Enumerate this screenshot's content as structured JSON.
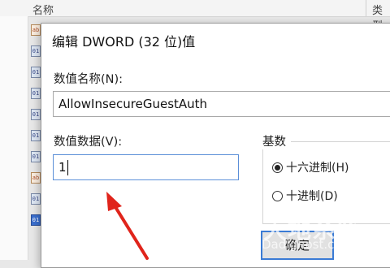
{
  "background": {
    "column_name": "名称",
    "column_type": "类型",
    "row_icons": [
      {
        "glyph": "ab",
        "kind": "string"
      },
      {
        "glyph": "01",
        "kind": "binary"
      },
      {
        "glyph": "01",
        "kind": "binary"
      },
      {
        "glyph": "01",
        "kind": "binary"
      },
      {
        "glyph": "01",
        "kind": "binary"
      },
      {
        "glyph": "01",
        "kind": "binary"
      },
      {
        "glyph": "01",
        "kind": "binary"
      },
      {
        "glyph": "ab",
        "kind": "string"
      },
      {
        "glyph": "01",
        "kind": "binary"
      },
      {
        "glyph": "01",
        "kind": "selected"
      }
    ]
  },
  "dialog": {
    "title": "编辑 DWORD (32 位)值",
    "value_name_label": "数值名称(N):",
    "value_name": "AllowInsecureGuestAuth",
    "value_data_label": "数值数据(V):",
    "value_data": "1",
    "base_label": "基数",
    "base_options": [
      {
        "label": "十六进制(H)",
        "checked": true
      },
      {
        "label": "十进制(D)",
        "checked": false
      }
    ],
    "ok_label": "确定"
  },
  "annotation": {
    "color": "#e0241b"
  },
  "watermark": {
    "text_cn": "大地系统",
    "text_en": "Dadighost.com"
  }
}
